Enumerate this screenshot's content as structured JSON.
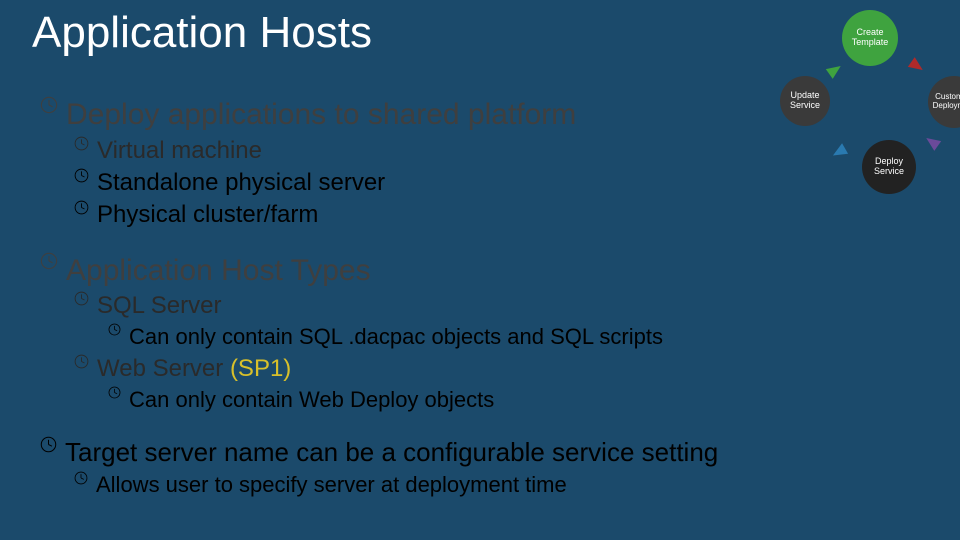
{
  "title": "Application Hosts",
  "bullets": {
    "b1": "Deploy applications to shared platform",
    "b1a": "Virtual machine",
    "b1b": "Standalone physical server",
    "b1c": "Physical cluster/farm",
    "b2": "Application Host Types",
    "b2a": "SQL Server",
    "b2a1": "Can only contain SQL .dacpac objects and SQL scripts",
    "b2b_prefix": "Web Server ",
    "b2b_suffix": "(SP1)",
    "b2b1": "Can only contain Web Deploy objects",
    "b3": "Target server name can be a configurable service setting",
    "b3a": "Allows user to specify server at deployment time"
  },
  "cycle": {
    "create": "Create Template",
    "update": "Update Service",
    "deploy": "Deploy Service",
    "customize": "Customize Deployment"
  }
}
